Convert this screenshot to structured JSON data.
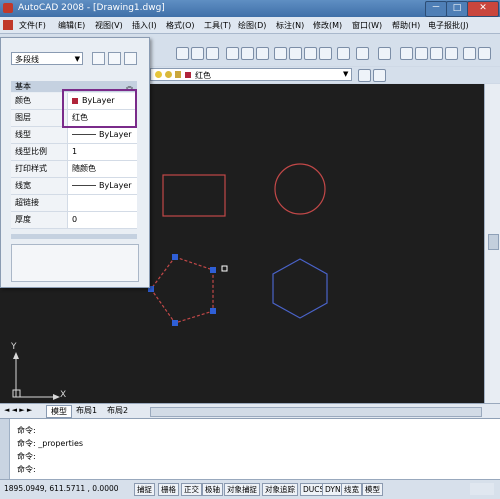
{
  "window": {
    "title": "AutoCAD 2008 - [Drawing1.dwg]"
  },
  "window_buttons": {
    "minimize": "－",
    "restore": "□",
    "close": "✕"
  },
  "menu": [
    "文件(F)",
    "编辑(E)",
    "视图(V)",
    "插入(I)",
    "格式(O)",
    "工具(T)",
    "绘图(D)",
    "标注(N)",
    "修改(M)",
    "窗口(W)",
    "帮助(H)",
    "电子报批(J)"
  ],
  "layer_bar": {
    "layer_name": "红色"
  },
  "properties": {
    "selection": "多段线",
    "group_title": "基本",
    "rows": [
      {
        "key": "颜色",
        "value": "ByLayer"
      },
      {
        "key": "图层",
        "value": "红色"
      },
      {
        "key": "线型",
        "value": "ByLayer"
      },
      {
        "key": "线型比例",
        "value": "1"
      },
      {
        "key": "打印样式",
        "value": "随颜色"
      },
      {
        "key": "线宽",
        "value": "ByLayer"
      },
      {
        "key": "超链接",
        "value": ""
      },
      {
        "key": "厚度",
        "value": "0"
      }
    ]
  },
  "canvas": {
    "axis_x": "X",
    "axis_y": "Y"
  },
  "tabs": [
    "模型",
    "布局1",
    "布局2"
  ],
  "command_lines": [
    "命令:",
    "命令:  _properties",
    "命令:",
    "命令:"
  ],
  "status": {
    "coords": "1895.0949,  611.5711 ,  0.0000",
    "buttons": [
      "捕捉",
      "栅格",
      "正交",
      "极轴",
      "对象捕捉",
      "对象追踪",
      "DUCS",
      "DYN",
      "线宽",
      "模型"
    ]
  },
  "colors": {
    "accent": "#7a2b8a",
    "layer_red": "#b0243a",
    "canvas": "#1e1e1e"
  }
}
